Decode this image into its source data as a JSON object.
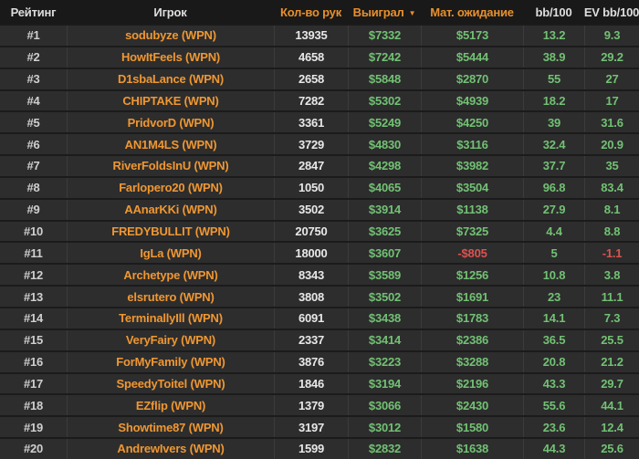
{
  "table": {
    "columns": [
      {
        "id": "rank",
        "label": "Рейтинг",
        "accent": false,
        "sorted": false
      },
      {
        "id": "player",
        "label": "Игрок",
        "accent": false,
        "sorted": false
      },
      {
        "id": "hands",
        "label": "Кол-во рук",
        "accent": true,
        "sorted": false
      },
      {
        "id": "won",
        "label": "Выиграл",
        "accent": true,
        "sorted": true
      },
      {
        "id": "ev",
        "label": "Мат. ожидание",
        "accent": true,
        "sorted": false
      },
      {
        "id": "bb100",
        "label": "bb/100",
        "accent": false,
        "sorted": false
      },
      {
        "id": "evbb100",
        "label": "EV bb/100",
        "accent": false,
        "sorted": false
      }
    ],
    "sort_icon": "▼",
    "sort_direction": "desc",
    "rows": [
      {
        "rank": "#1",
        "player": "sodubyze (WPN)",
        "hands": "13935",
        "won": "$7332",
        "ev": "$5173",
        "bb100": "13.2",
        "evbb100": "9.3"
      },
      {
        "rank": "#2",
        "player": "HowItFeels (WPN)",
        "hands": "4658",
        "won": "$7242",
        "ev": "$5444",
        "bb100": "38.9",
        "evbb100": "29.2"
      },
      {
        "rank": "#3",
        "player": "D1sbaLance (WPN)",
        "hands": "2658",
        "won": "$5848",
        "ev": "$2870",
        "bb100": "55",
        "evbb100": "27"
      },
      {
        "rank": "#4",
        "player": "CHIPTAKE (WPN)",
        "hands": "7282",
        "won": "$5302",
        "ev": "$4939",
        "bb100": "18.2",
        "evbb100": "17"
      },
      {
        "rank": "#5",
        "player": "PridvorD (WPN)",
        "hands": "3361",
        "won": "$5249",
        "ev": "$4250",
        "bb100": "39",
        "evbb100": "31.6"
      },
      {
        "rank": "#6",
        "player": "AN1M4LS (WPN)",
        "hands": "3729",
        "won": "$4830",
        "ev": "$3116",
        "bb100": "32.4",
        "evbb100": "20.9"
      },
      {
        "rank": "#7",
        "player": "RiverFoldsInU (WPN)",
        "hands": "2847",
        "won": "$4298",
        "ev": "$3982",
        "bb100": "37.7",
        "evbb100": "35"
      },
      {
        "rank": "#8",
        "player": "Farlopero20 (WPN)",
        "hands": "1050",
        "won": "$4065",
        "ev": "$3504",
        "bb100": "96.8",
        "evbb100": "83.4"
      },
      {
        "rank": "#9",
        "player": "AAnarKKi (WPN)",
        "hands": "3502",
        "won": "$3914",
        "ev": "$1138",
        "bb100": "27.9",
        "evbb100": "8.1"
      },
      {
        "rank": "#10",
        "player": "FREDYBULLIT (WPN)",
        "hands": "20750",
        "won": "$3625",
        "ev": "$7325",
        "bb100": "4.4",
        "evbb100": "8.8"
      },
      {
        "rank": "#11",
        "player": "IgLa (WPN)",
        "hands": "18000",
        "won": "$3607",
        "ev": "-$805",
        "bb100": "5",
        "evbb100": "-1.1"
      },
      {
        "rank": "#12",
        "player": "Archetype (WPN)",
        "hands": "8343",
        "won": "$3589",
        "ev": "$1256",
        "bb100": "10.8",
        "evbb100": "3.8"
      },
      {
        "rank": "#13",
        "player": "elsrutero (WPN)",
        "hands": "3808",
        "won": "$3502",
        "ev": "$1691",
        "bb100": "23",
        "evbb100": "11.1"
      },
      {
        "rank": "#14",
        "player": "TerminallyIll (WPN)",
        "hands": "6091",
        "won": "$3438",
        "ev": "$1783",
        "bb100": "14.1",
        "evbb100": "7.3"
      },
      {
        "rank": "#15",
        "player": "VeryFairy (WPN)",
        "hands": "2337",
        "won": "$3414",
        "ev": "$2386",
        "bb100": "36.5",
        "evbb100": "25.5"
      },
      {
        "rank": "#16",
        "player": "ForMyFamily (WPN)",
        "hands": "3876",
        "won": "$3223",
        "ev": "$3288",
        "bb100": "20.8",
        "evbb100": "21.2"
      },
      {
        "rank": "#17",
        "player": "SpeedyToitel (WPN)",
        "hands": "1846",
        "won": "$3194",
        "ev": "$2196",
        "bb100": "43.3",
        "evbb100": "29.7"
      },
      {
        "rank": "#18",
        "player": "EZflip (WPN)",
        "hands": "1379",
        "won": "$3066",
        "ev": "$2430",
        "bb100": "55.6",
        "evbb100": "44.1"
      },
      {
        "rank": "#19",
        "player": "Showtime87 (WPN)",
        "hands": "3197",
        "won": "$3012",
        "ev": "$1580",
        "bb100": "23.6",
        "evbb100": "12.4"
      },
      {
        "rank": "#20",
        "player": "AndrewIvers (WPN)",
        "hands": "1599",
        "won": "$2832",
        "ev": "$1638",
        "bb100": "44.3",
        "evbb100": "25.6"
      }
    ]
  },
  "colors": {
    "header_bg": "#191919",
    "row_bg": "#2d2d2d",
    "accent_orange": "#e8902d",
    "player_orange": "#ef9732",
    "positive_green": "#72c174",
    "negative_red": "#d9534f"
  }
}
